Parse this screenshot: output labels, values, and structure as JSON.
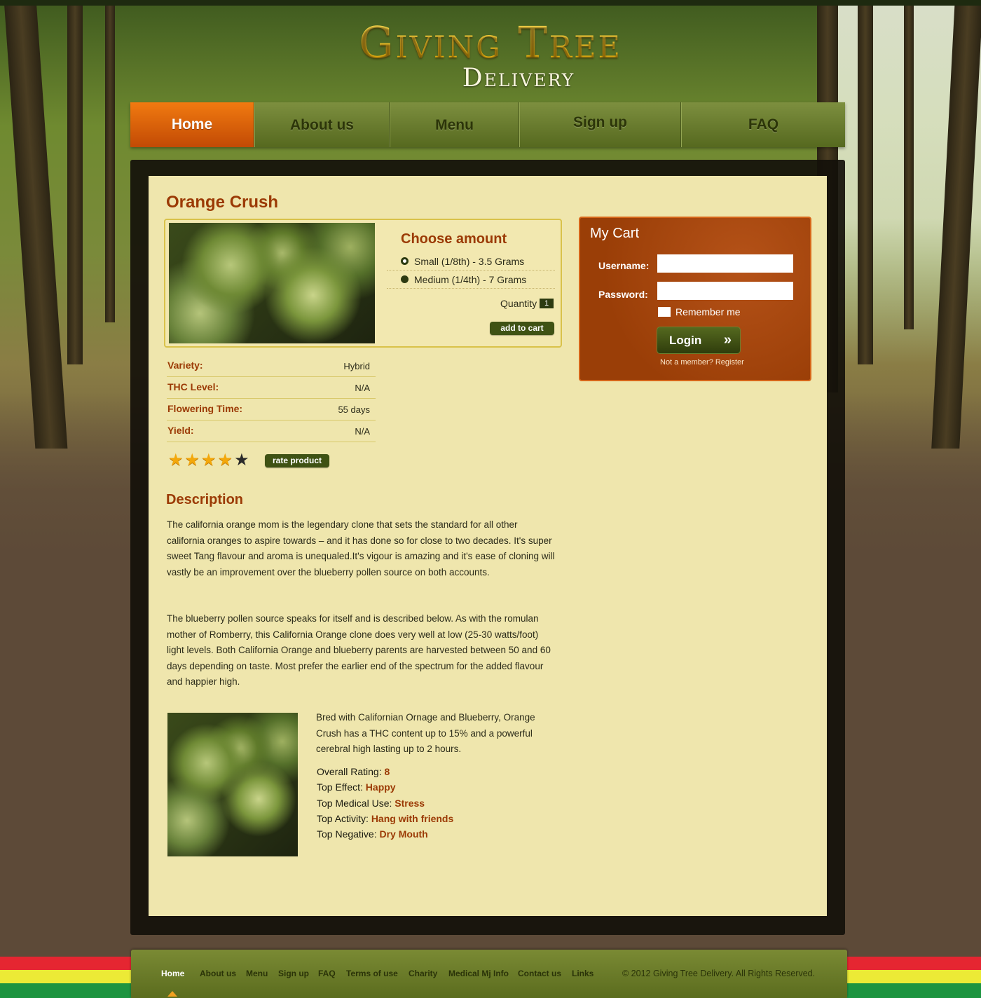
{
  "logo": {
    "main": "Giving Tree",
    "sub": "Delivery"
  },
  "nav": [
    "Home",
    "About us",
    "Menu",
    "Sign up",
    "FAQ"
  ],
  "product": {
    "title": "Orange Crush",
    "choose_title": "Choose amount",
    "options": [
      "Small (1/8th) - 3.5 Grams",
      "Medium (1/4th) - 7 Grams"
    ],
    "quantity_label": "Quantity",
    "quantity_value": "1",
    "add_to_cart": "add to cart",
    "specs": [
      {
        "label": "Variety:",
        "value": "Hybrid"
      },
      {
        "label": "THC Level:",
        "value": "N/A"
      },
      {
        "label": "Flowering Time:",
        "value": "55 days"
      },
      {
        "label": "Yield:",
        "value": "N/A"
      }
    ],
    "rating_stars": 4,
    "rating_max": 5,
    "rate_button": "rate product"
  },
  "description": {
    "title": "Description",
    "paragraph1": "The california orange mom is the legendary clone that sets the standard for all other california oranges to aspire towards – and it has done so for close to two decades. It's super sweet Tang flavour and aroma is unequaled.It's vigour is amazing and it's ease of cloning will vastly be an improvement over the blueberry pollen source on both accounts.",
    "paragraph2": "The blueberry pollen source speaks for itself and is described below. As with the romulan mother of Romberry, this California Orange clone does very well at low (25-30 watts/foot) light levels. Both California Orange and blueberry parents are harvested between 50 and 60 days depending on taste. Most prefer the earlier end of the spectrum for the added flavour and happier high.",
    "paragraph3": "Bred with Californian Ornage and Blueberry, Orange Crush has a THC content up to 15% and a powerful cerebral high lasting up to 2 hours.",
    "stats": [
      {
        "label": "Overall Rating",
        "value": "8"
      },
      {
        "label": "Top Effect",
        "value": "Happy"
      },
      {
        "label": "Top Medical Use",
        "value": "Stress"
      },
      {
        "label": "Top Activity",
        "value": "Hang with friends"
      },
      {
        "label": "Top Negative",
        "value": "Dry Mouth"
      }
    ]
  },
  "cart": {
    "title": "My Cart",
    "username_label": "Username:",
    "password_label": "Password:",
    "username_value": "",
    "password_value": "",
    "remember_label": "Remember me",
    "login_label": "Login",
    "login_arrow": "»",
    "register_text": "Not a member? Register"
  },
  "footer": {
    "links": [
      "Home",
      "About us",
      "Menu",
      "Sign up",
      "FAQ",
      "Terms of use",
      "Charity",
      "Medical Mj Info",
      "Contact us",
      "Links"
    ],
    "copyright": "© 2012 Giving  Tree Delivery. All Rights Reserved."
  },
  "colors": {
    "accent_orange": "#c24a05",
    "heading_brown": "#9b3a05",
    "nav_green": "#56691f",
    "content_bg": "#efe6ad",
    "stripe_red": "#e52631",
    "stripe_yellow": "#ecea36",
    "stripe_green": "#1d9440"
  }
}
